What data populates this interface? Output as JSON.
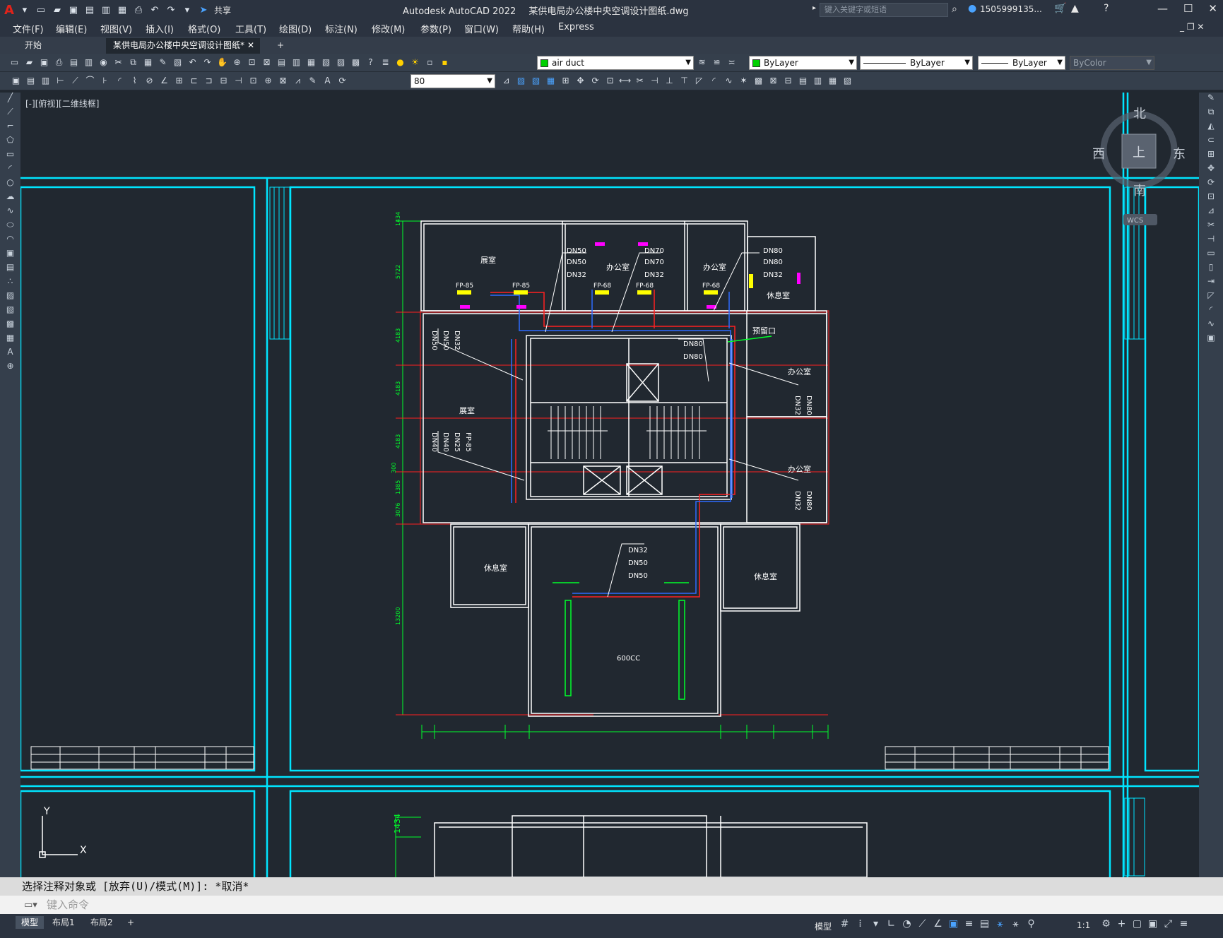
{
  "app": {
    "title": "Autodesk AutoCAD 2022",
    "filename": "某供电局办公楼中央空调设计图纸.dwg",
    "share_label": "共享",
    "search_placeholder": "键入关键字或短语",
    "user": "1505999135...",
    "accent_red": "#e2231a"
  },
  "menu": [
    "文件(F)",
    "编辑(E)",
    "视图(V)",
    "插入(I)",
    "格式(O)",
    "工具(T)",
    "绘图(D)",
    "标注(N)",
    "修改(M)",
    "参数(P)",
    "窗口(W)",
    "帮助(H)",
    "Express"
  ],
  "tabs": {
    "start": "开始",
    "doc": "某供电局办公楼中央空调设计图纸*",
    "close": "✕",
    "add": "+"
  },
  "toolbar": {
    "layer": "air duct",
    "color": "ByLayer",
    "linetype": "ByLayer",
    "lineweight": "ByLayer",
    "plotstyle": "ByColor",
    "dimscale": "80"
  },
  "viewport": {
    "label": "[-][俯视][二维线框]",
    "compass": {
      "north": "北",
      "south": "南",
      "east": "东",
      "west": "西",
      "top": "上",
      "wcs": "WCS"
    },
    "ucs": {
      "x": "X",
      "y": "Y"
    }
  },
  "drawing": {
    "rooms": [
      "展室",
      "办公室",
      "办公室",
      "休息室",
      "展室",
      "办公室",
      "办公室",
      "休息室",
      "休息室",
      "预留口"
    ],
    "fancoils": [
      "FP-85",
      "FP-85",
      "FP-68",
      "FP-68",
      "FP-68",
      "FP-85"
    ],
    "pipe_labels_a": [
      "DN50",
      "DN50",
      "DN32"
    ],
    "pipe_labels_b": [
      "DN70",
      "DN70",
      "DN32"
    ],
    "pipe_labels_c": [
      "DN80",
      "DN80",
      "DN32"
    ],
    "pipe_labels_d": [
      "DN80",
      "DN80"
    ],
    "pipe_labels_e": [
      "DN32",
      "DN50",
      "DN50"
    ],
    "vertical_labels_left": [
      "DN50",
      "DN50",
      "DN32"
    ],
    "vertical_labels_left2": [
      "DN40",
      "DN40",
      "DN25",
      "FP-85"
    ],
    "vertical_labels_right": [
      "DN32",
      "DN80"
    ],
    "vertical_labels_right2": [
      "DN32",
      "DN80"
    ],
    "unit_label": "600CC",
    "dim_left": [
      "1434",
      "5722",
      "4183",
      "4183",
      "4183",
      "300",
      "1385",
      "3076",
      "13200"
    ],
    "bottom_dim": "1434",
    "colors": {
      "cyan": "#00e5ff",
      "white": "#ffffff",
      "red": "#ff2020",
      "green": "#00ff2a",
      "blue": "#2e6bff",
      "magenta": "#ff00ff",
      "yellow": "#ffff00"
    }
  },
  "command": {
    "history": "选择注释对象或 [放弃(U)/模式(M)]: *取消*",
    "placeholder": "键入命令"
  },
  "layouts": [
    "模型",
    "布局1",
    "布局2"
  ],
  "status": {
    "model": "模型",
    "scale": "1:1"
  }
}
